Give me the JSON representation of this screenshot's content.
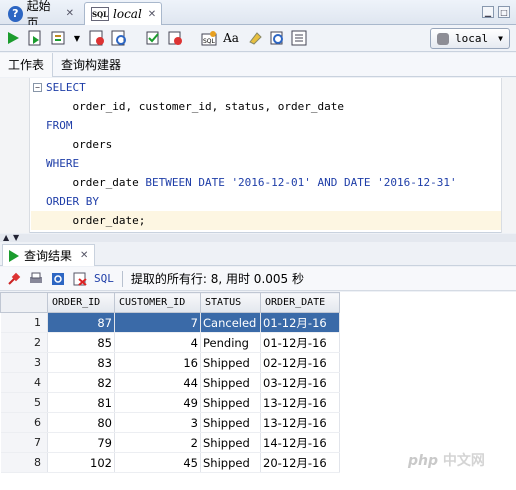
{
  "tabs": [
    {
      "label": "起始页",
      "icon": "help-icon"
    },
    {
      "label": "local",
      "icon": "sql-worksheet-icon"
    }
  ],
  "toolbar": {
    "connection": "local"
  },
  "subtabs": [
    "工作表",
    "查询构建器"
  ],
  "editor": {
    "lines": [
      {
        "type": "kw",
        "text": "SELECT"
      },
      {
        "type": "code",
        "text": "    order_id, customer_id, status, order_date"
      },
      {
        "type": "kw",
        "text": "FROM"
      },
      {
        "type": "code",
        "text": "    orders"
      },
      {
        "type": "kw",
        "text": "WHERE"
      },
      {
        "type": "mixed",
        "parts": [
          "    order_date ",
          "BETWEEN DATE ",
          "'2016-12-01'",
          " AND DATE ",
          "'2016-12-31'"
        ]
      },
      {
        "type": "kw",
        "text": "ORDER BY"
      },
      {
        "type": "code",
        "text": "    order_date;"
      }
    ]
  },
  "result": {
    "tab_label": "查询结果",
    "sql_label": "SQL",
    "status": "提取的所有行: 8, 用时 0.005 秒",
    "columns": [
      "ORDER_ID",
      "CUSTOMER_ID",
      "STATUS",
      "ORDER_DATE"
    ],
    "rows": [
      [
        "1",
        "87",
        "7",
        "Canceled",
        "01-12月-16"
      ],
      [
        "2",
        "85",
        "4",
        "Pending",
        "01-12月-16"
      ],
      [
        "3",
        "83",
        "16",
        "Shipped",
        "02-12月-16"
      ],
      [
        "4",
        "82",
        "44",
        "Shipped",
        "03-12月-16"
      ],
      [
        "5",
        "81",
        "49",
        "Shipped",
        "13-12月-16"
      ],
      [
        "6",
        "80",
        "3",
        "Shipped",
        "13-12月-16"
      ],
      [
        "7",
        "79",
        "2",
        "Shipped",
        "14-12月-16"
      ],
      [
        "8",
        "102",
        "45",
        "Shipped",
        "20-12月-16"
      ]
    ],
    "selected_row": 0
  },
  "watermark": {
    "prefix": "php",
    "suffix": "中文网"
  }
}
